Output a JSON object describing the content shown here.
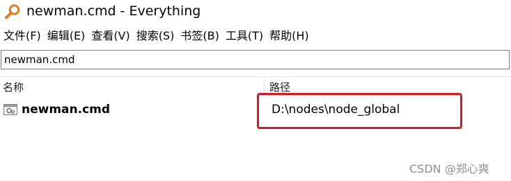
{
  "window": {
    "title": "newman.cmd - Everything",
    "icon": "magnifier-icon"
  },
  "menu": {
    "items": [
      {
        "label": "文件(F)"
      },
      {
        "label": "编辑(E)"
      },
      {
        "label": "查看(V)"
      },
      {
        "label": "搜索(S)"
      },
      {
        "label": "书签(B)"
      },
      {
        "label": "工具(T)"
      },
      {
        "label": "帮助(H)"
      }
    ]
  },
  "search": {
    "value": "newman.cmd"
  },
  "columns": {
    "name": "名称",
    "path": "路径"
  },
  "results": [
    {
      "name": "newman.cmd",
      "path": "D:\\nodes\\node_global",
      "icon": "cmd-file-icon"
    }
  ],
  "annotation": {
    "color": "#e0141e"
  },
  "watermark": {
    "text": "CSDN @郑心爽"
  }
}
